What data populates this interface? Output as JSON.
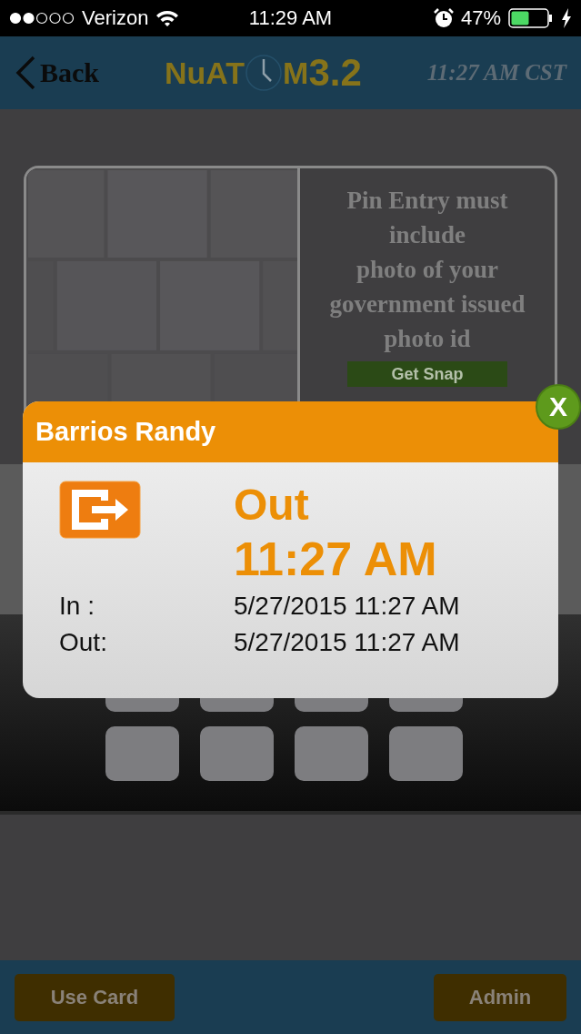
{
  "status_bar": {
    "carrier": "Verizon",
    "time": "11:29 AM",
    "battery_percent": "47%"
  },
  "header": {
    "back": "Back",
    "logo": {
      "left": "NuAT",
      "middle": "M",
      "version": "3.2"
    },
    "clock": "11:27 AM CST"
  },
  "photo_card": {
    "message": "Pin Entry must\ninclude\nphoto of your\ngovernment issued\nphoto id",
    "snap_button": "Get Snap"
  },
  "footer": {
    "left_button": "Use Card",
    "right_button": "Admin"
  },
  "popup": {
    "name": "Barrios Randy",
    "close": "X",
    "kind": "out",
    "action": "Out",
    "time": "11:27 AM",
    "rows": [
      {
        "label": "In :",
        "value": "5/27/2015 11:27 AM"
      },
      {
        "label": "Out:",
        "value": "5/27/2015 11:27 AM"
      }
    ]
  }
}
